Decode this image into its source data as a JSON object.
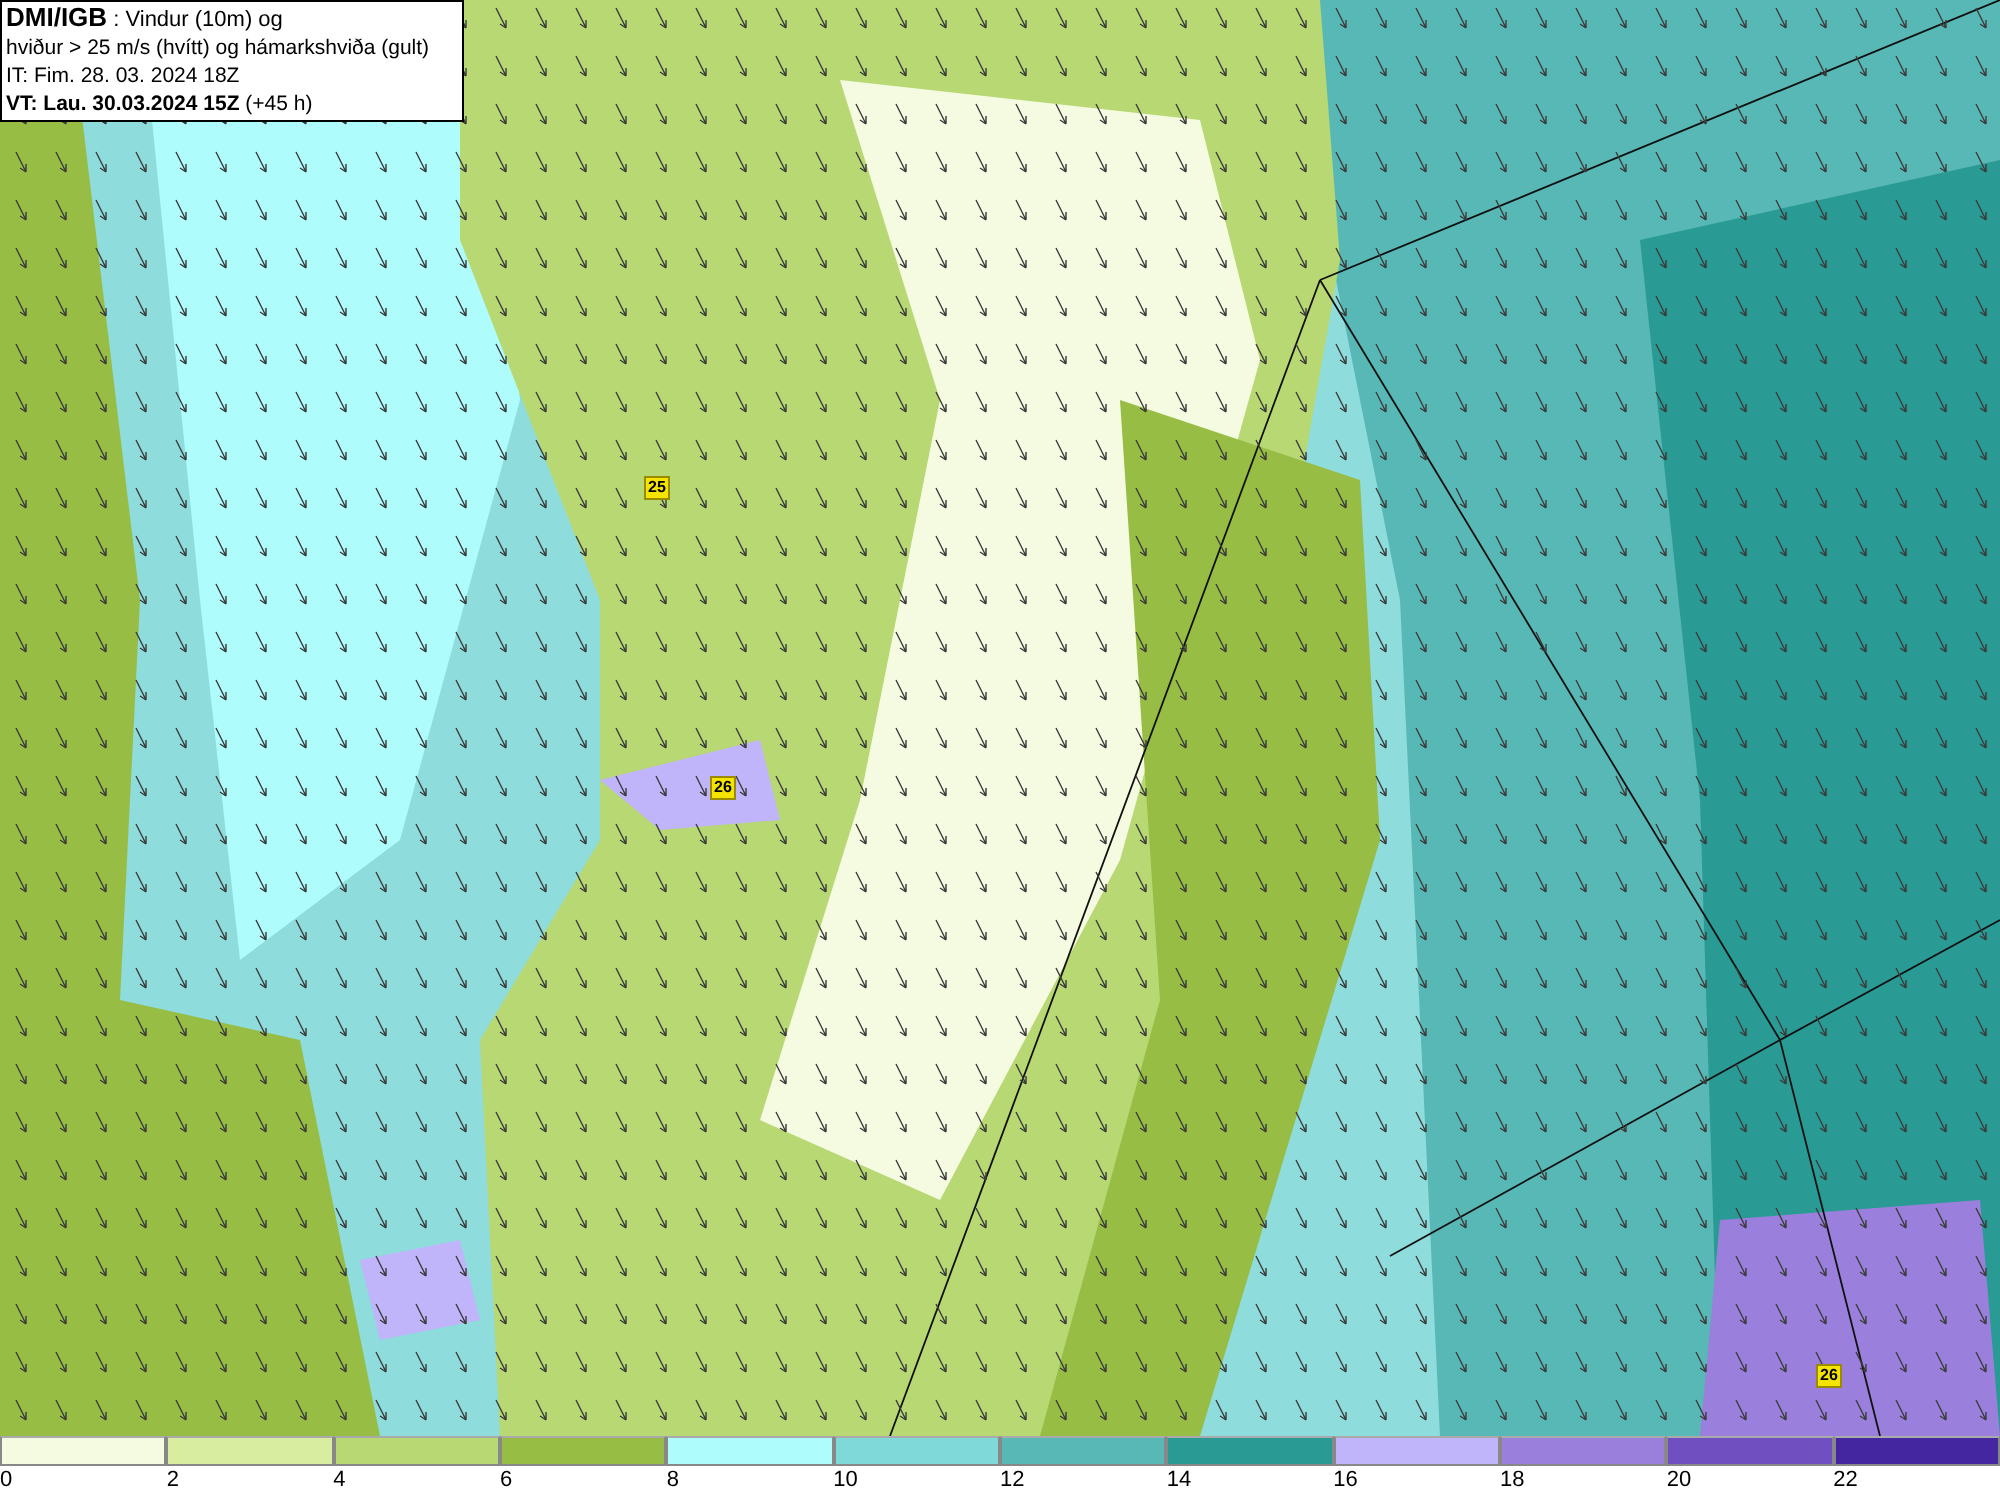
{
  "header": {
    "lines": [
      "**DMI/IGB** : Vindur (10m) og",
      "hviður > 25 m/s (hvítt) og hámarkshviða (gult)",
      "IT: Fim. 28. 03. 2024 18Z",
      "**VT: Lau. 30.03.2024 15Z** (+45 h)"
    ]
  },
  "gust_markers": [
    {
      "label": "25"
    },
    {
      "label": "26"
    },
    {
      "label": "26"
    }
  ],
  "legend": {
    "bins": [
      {
        "color": "#f5fbe0"
      },
      {
        "color": "#d9eda0"
      },
      {
        "color": "#b7d873"
      },
      {
        "color": "#97bd45"
      },
      {
        "color": "#aefcfb"
      },
      {
        "color": "#7fd9d8"
      },
      {
        "color": "#58b8b5"
      },
      {
        "color": "#2a9a94"
      },
      {
        "color": "#c0b4fa"
      },
      {
        "color": "#9a80dc"
      },
      {
        "color": "#7050c0"
      },
      {
        "color": "#4426a0"
      }
    ],
    "ticks": [
      "0",
      "2",
      "4",
      "6",
      "8",
      "10",
      "12",
      "14",
      "16",
      "18",
      "20",
      "22"
    ]
  }
}
